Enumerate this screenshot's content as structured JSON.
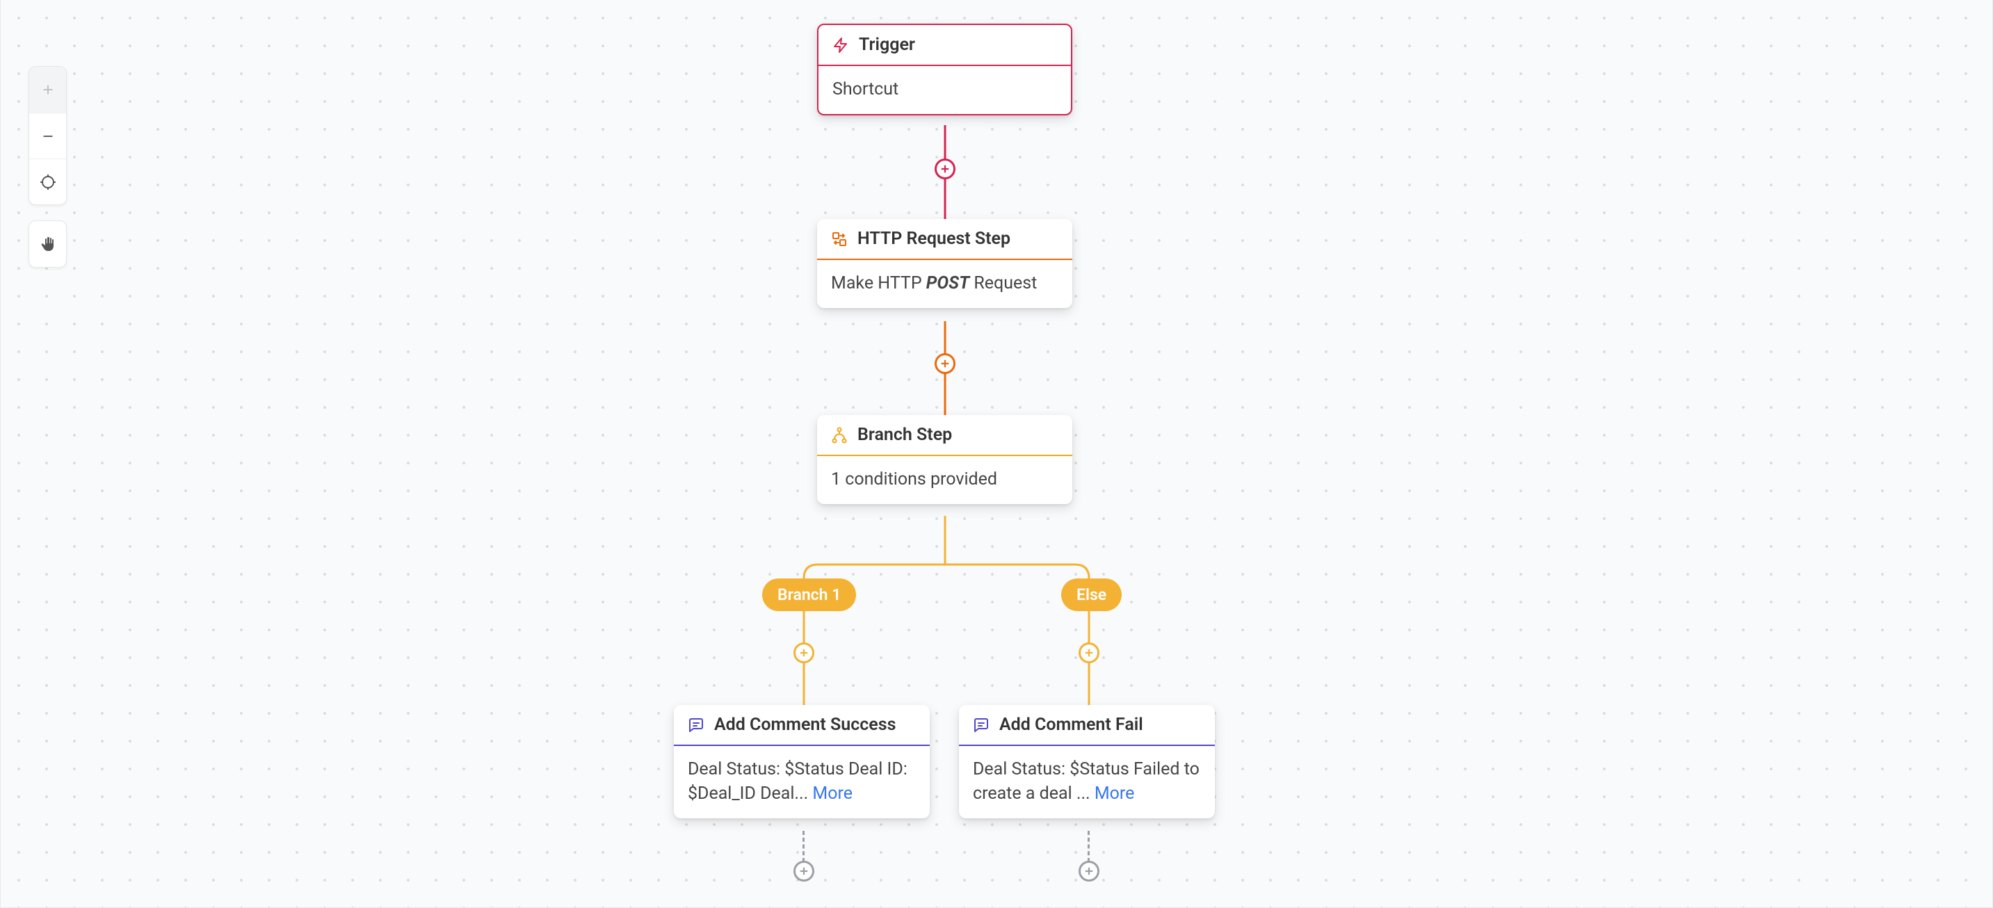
{
  "colors": {
    "trigger": "#d5234f",
    "http": "#ea6a0c",
    "branch_accent": "#f1a71c",
    "branch_line": "#f4b234",
    "comment": "#4e46d0",
    "terminal": "#9aa0a6"
  },
  "toolbar": {
    "zoom_in": "zoom-in",
    "zoom_out": "zoom-out",
    "recenter": "recenter",
    "pan": "pan-hand"
  },
  "nodes": {
    "trigger": {
      "title": "Trigger",
      "body": "Shortcut"
    },
    "http": {
      "title": "HTTP Request Step",
      "body_prefix": "Make HTTP ",
      "body_method": "POST",
      "body_suffix": " Request"
    },
    "branch": {
      "title": "Branch Step",
      "body": "1 conditions provided"
    },
    "branch_labels": {
      "branch1": "Branch 1",
      "else_": "Else"
    },
    "comment_success": {
      "title": "Add Comment Success",
      "body": "Deal Status: $Status Deal ID: $Deal_ID Deal... ",
      "more": "More"
    },
    "comment_fail": {
      "title": "Add Comment Fail",
      "body": "Deal Status: $Status Failed to create a deal ... ",
      "more": "More"
    }
  }
}
